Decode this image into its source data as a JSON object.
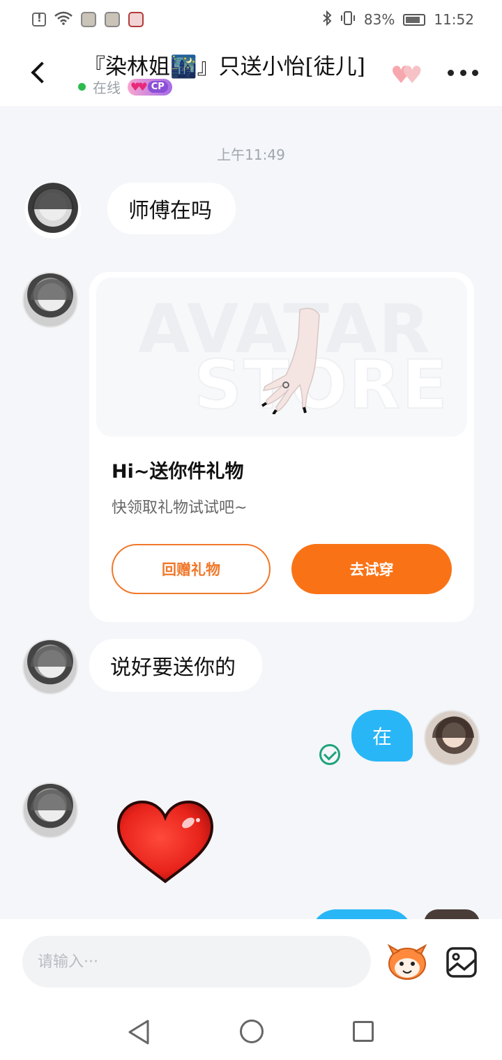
{
  "status_bar": {
    "battery_percent": "83%",
    "time": "11:52",
    "icons": [
      "alert-icon",
      "wifi-icon",
      "app-icon",
      "app-icon",
      "screen-record-icon",
      "bluetooth-icon",
      "vibrate-icon",
      "battery-icon"
    ]
  },
  "header": {
    "contact_name": "『染林姐🌃』只送小怡[徒儿]",
    "status": "在线",
    "cp_badge": "CP",
    "back_icon": "chevron-left-icon",
    "hearts_icon": "double-heart-icon",
    "more_icon": "more-dots-icon"
  },
  "chat": {
    "timestamp": "上午11:49",
    "messages": [
      {
        "sender": "other",
        "avatar": "cat-girl-avatar",
        "text": "师傅在吗"
      },
      {
        "sender": "other",
        "type": "gift-card",
        "banner_text_1": "AVATAR",
        "banner_text_2": "STORE",
        "title": "Hi~送你件礼物",
        "subtitle": "快领取礼物试试吧~",
        "return_button": "回赠礼物",
        "try_button": "去试穿"
      },
      {
        "sender": "other",
        "text": "说好要送你的"
      },
      {
        "sender": "self",
        "text": "在",
        "read": true
      },
      {
        "sender": "other",
        "type": "sticker",
        "sticker": "red-heart-sticker"
      }
    ]
  },
  "input_bar": {
    "placeholder": "请输入···",
    "emoji_icon": "mascot-emoji-icon",
    "image_icon": "image-icon"
  },
  "nav_bar": {
    "buttons": [
      "nav-back-icon",
      "nav-home-icon",
      "nav-recent-icon"
    ]
  },
  "colors": {
    "accent_orange": "#f97316",
    "self_bubble_blue": "#29b6f6",
    "online_green": "#2dbb4c",
    "background": "#f4f6f9"
  }
}
